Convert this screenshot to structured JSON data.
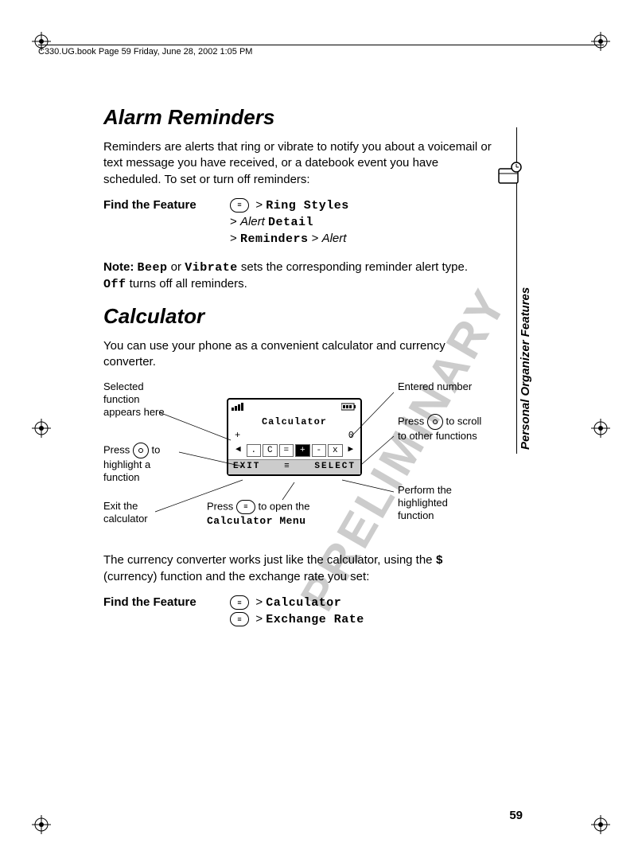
{
  "header": {
    "book_line": "C330.UG.book  Page 59  Friday, June 28, 2002  1:05 PM"
  },
  "section_tab": "Personal Organizer Features",
  "watermark": "PRELIMINARY",
  "page_number": "59",
  "alarm": {
    "title": "Alarm Reminders",
    "intro": "Reminders are alerts that ring or vibrate to notify you about a voicemail or text message you have received, or a datebook event you have scheduled. To set or turn off reminders:",
    "ftf_label": "Find the Feature",
    "path": {
      "gt1": ">",
      "ring_styles": "Ring Styles",
      "gt2": ">",
      "alert": "Alert",
      "detail": "Detail",
      "gt3": ">",
      "reminders": "Reminders",
      "gt4": ">",
      "alert2": "Alert"
    },
    "note_label": "Note:",
    "note_beep": "Beep",
    "note_or": " or ",
    "note_vibrate": "Vibrate",
    "note_mid": " sets the corresponding reminder alert type. ",
    "note_off": "Off",
    "note_end": " turns off all reminders."
  },
  "calculator": {
    "title": "Calculator",
    "intro": "You can use your phone as a convenient calculator and currency converter.",
    "callouts": {
      "sel_func": "Selected function appears here",
      "press_highlight": "Press   to highlight a function",
      "exit": "Exit the calculator",
      "press_open_pre": "Press ",
      "press_open_post": " to open the ",
      "calc_menu": "Calculator Menu",
      "entered": "Entered number",
      "press_scroll_pre": "Press ",
      "press_scroll_post": " to scroll to other functions",
      "perform": "Perform the highlighted function"
    },
    "screen": {
      "title": "Calculator",
      "plus": "+",
      "zero": "0",
      "funcs": [
        ".",
        "C",
        "=",
        "+",
        "-",
        "x"
      ],
      "hl_index": 3,
      "soft_left": "EXIT",
      "soft_right": "SELECT"
    },
    "outro_pre": "The currency converter works just like the calculator, using the ",
    "outro_dollar": "$",
    "outro_post": " (currency) function and the exchange rate you set:",
    "ftf_label": "Find the Feature",
    "path2": {
      "gt1": ">",
      "calc": "Calculator",
      "gt2": ">",
      "exch": "Exchange Rate"
    }
  }
}
